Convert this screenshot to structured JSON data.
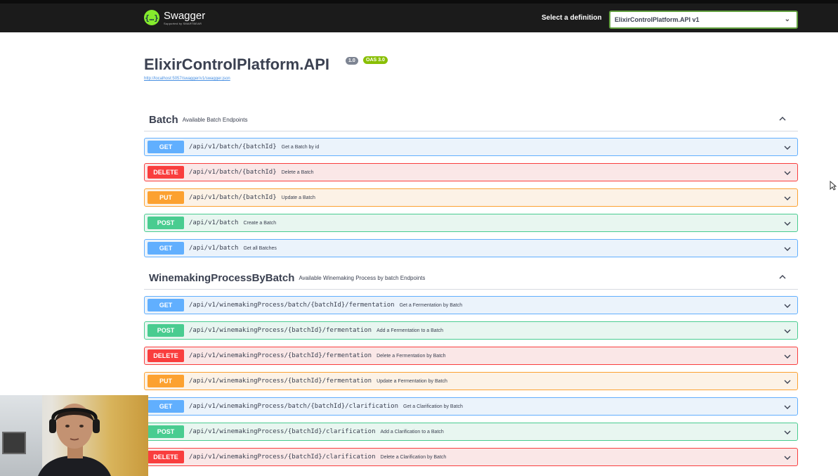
{
  "topbar": {
    "logo_mark": "{…}",
    "logo_name": "Swagger",
    "logo_sub": "Supported by SMARTBEAR",
    "definition_label": "Select a definition",
    "definition_value": "ElixirControlPlatform.API v1"
  },
  "info": {
    "title": "ElixirControlPlatform.API",
    "version": "1.0",
    "oas": "OAS 3.0",
    "url": "http://localhost:5057/swagger/v1/swagger.json"
  },
  "tags": [
    {
      "name": "Batch",
      "description": "Available Batch Endpoints",
      "operations": [
        {
          "method": "GET",
          "path": "/api/v1/batch/{batchId}",
          "summary": "Get a Batch by id"
        },
        {
          "method": "DELETE",
          "path": "/api/v1/batch/{batchId}",
          "summary": "Delete a Batch"
        },
        {
          "method": "PUT",
          "path": "/api/v1/batch/{batchId}",
          "summary": "Update a Batch"
        },
        {
          "method": "POST",
          "path": "/api/v1/batch",
          "summary": "Create a Batch"
        },
        {
          "method": "GET",
          "path": "/api/v1/batch",
          "summary": "Get all Batches"
        }
      ]
    },
    {
      "name": "WinemakingProcessByBatch",
      "description": "Available Winemaking Process by batch Endpoints",
      "operations": [
        {
          "method": "GET",
          "path": "/api/v1/winemakingProcess/batch/{batchId}/fermentation",
          "summary": "Get a Fermentation by Batch"
        },
        {
          "method": "POST",
          "path": "/api/v1/winemakingProcess/{batchId}/fermentation",
          "summary": "Add a Fermentation to a Batch"
        },
        {
          "method": "DELETE",
          "path": "/api/v1/winemakingProcess/{batchId}/fermentation",
          "summary": "Delete a Fermentation by Batch"
        },
        {
          "method": "PUT",
          "path": "/api/v1/winemakingProcess/{batchId}/fermentation",
          "summary": "Update a Fermentation by Batch"
        },
        {
          "method": "GET",
          "path": "/api/v1/winemakingProcess/batch/{batchId}/clarification",
          "summary": "Get a Clarification by Batch"
        },
        {
          "method": "POST",
          "path": "/api/v1/winemakingProcess/{batchId}/clarification",
          "summary": "Add a Clarification to a Batch"
        },
        {
          "method": "DELETE",
          "path": "/api/v1/winemakingProcess/{batchId}/clarification",
          "summary": "Delete a Clarification by Batch"
        }
      ]
    }
  ],
  "colors": {
    "get": "#61affe",
    "post": "#49cc90",
    "put": "#fca130",
    "delete": "#f93e3e",
    "topbar": "#1b1b1b"
  },
  "icons": {
    "collapse": "chevron-up-icon",
    "expand": "chevron-down-icon",
    "cursor": "mouse-pointer-icon"
  }
}
